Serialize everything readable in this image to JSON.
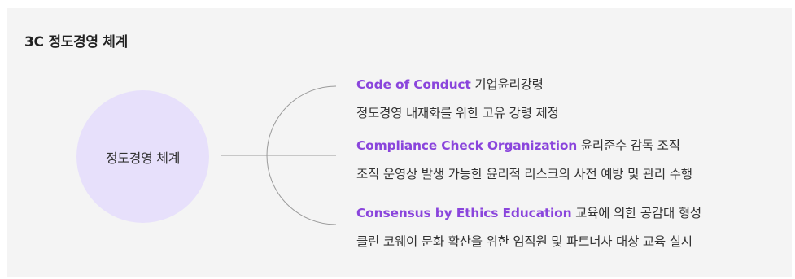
{
  "title": "3C 정도경영 체계",
  "center_label": "정도경영 체계",
  "accent_color": "#8a45dc",
  "circle_color": "#e7e0fb",
  "items": [
    {
      "en": "Code of Conduct",
      "ko": "기업윤리강령",
      "desc": "정도경영 내재화를 위한 고유 강령 제정"
    },
    {
      "en": "Compliance Check Organization",
      "ko": "윤리준수 감독 조직",
      "desc": "조직 운영상 발생 가능한 윤리적 리스크의 사전 예방 및 관리 수행"
    },
    {
      "en": "Consensus by Ethics Education",
      "ko": "교육에 의한 공감대 형성",
      "desc": "클린 코웨이 문화 확산을 위한 임직원 및 파트너사 대상 교육 실시"
    }
  ]
}
